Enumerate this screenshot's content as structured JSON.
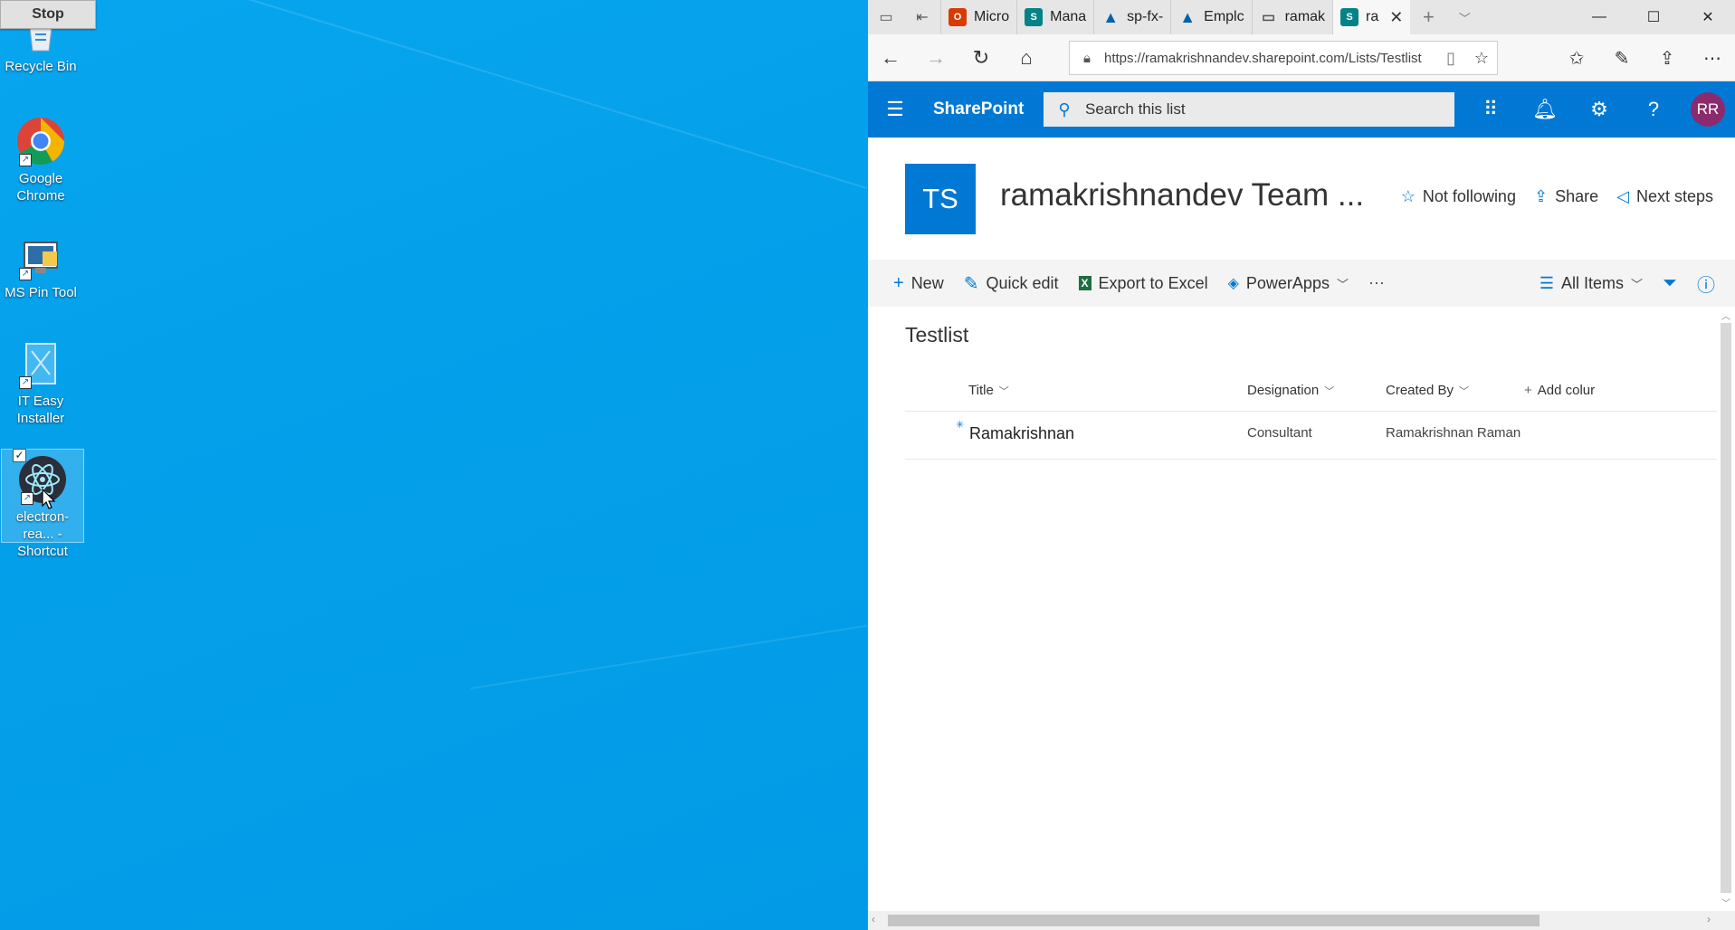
{
  "desktop": {
    "stop_label": "Stop",
    "icons": [
      {
        "label": "Recycle Bin"
      },
      {
        "label": "Google Chrome"
      },
      {
        "label": "MS Pin Tool"
      },
      {
        "label": "IT Easy Installer"
      },
      {
        "label": "electron-rea... - Shortcut"
      }
    ]
  },
  "browser": {
    "tabs": [
      {
        "label": "Micro",
        "icon": "office-icon",
        "color": "#d83b01"
      },
      {
        "label": "Mana",
        "icon": "sharepoint-icon",
        "color": "#038387"
      },
      {
        "label": "sp-fx-",
        "icon": "azure-icon",
        "color": "#0062ad"
      },
      {
        "label": "Emplc",
        "icon": "azure-icon",
        "color": "#0062ad"
      },
      {
        "label": "ramak",
        "icon": "page-icon",
        "color": "#555555"
      },
      {
        "label": "ra",
        "icon": "sharepoint-icon",
        "color": "#038387"
      }
    ],
    "url": "https://ramakrishnandev.sharepoint.com/Lists/Testlist"
  },
  "sharepoint": {
    "brand": "SharePoint",
    "search_placeholder": "Search this list",
    "avatar_initials": "RR",
    "site": {
      "logo_initials": "TS",
      "title": "ramakrishnandev Team ...",
      "actions": {
        "follow": "Not following",
        "share": "Share",
        "next_steps": "Next steps"
      }
    },
    "commands": {
      "new": "New",
      "quick_edit": "Quick edit",
      "export": "Export to Excel",
      "powerapps": "PowerApps",
      "view": "All Items"
    },
    "list": {
      "title": "Testlist",
      "columns": {
        "title": "Title",
        "designation": "Designation",
        "created_by": "Created By",
        "add_column": "Add colur"
      },
      "rows": [
        {
          "title": "Ramakrishnan",
          "designation": "Consultant",
          "created_by": "Ramakrishnan Raman"
        }
      ]
    }
  },
  "colors": {
    "desktop_blue": "#039de8",
    "sharepoint_blue": "#0078d4",
    "avatar": "#8c2a6e"
  }
}
